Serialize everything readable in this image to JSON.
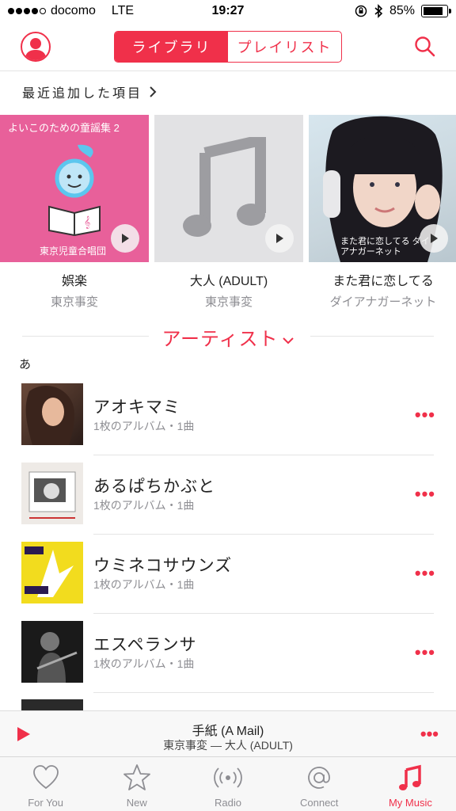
{
  "status": {
    "carrier": "docomo",
    "network": "LTE",
    "time": "19:27",
    "battery": "85%"
  },
  "header": {
    "segments": [
      "ライブラリ",
      "プレイリスト"
    ],
    "active_segment": 0
  },
  "recent": {
    "heading": "最近追加した項目",
    "albums": [
      {
        "title": "娯楽",
        "artist": "東京事変",
        "cover_text_top": "よいこのための童謡集 2",
        "cover_text_bottom": "東京児童合唱団"
      },
      {
        "title": "大人 (ADULT)",
        "artist": "東京事変"
      },
      {
        "title": "また君に恋してる",
        "artist": "ダイアナガーネット",
        "cover_text": "また君に恋してる ダイアナガーネット"
      }
    ]
  },
  "artists": {
    "heading": "アーティスト",
    "section_letter": "あ",
    "items": [
      {
        "name": "アオキマミ",
        "sub": "1枚のアルバム・1曲"
      },
      {
        "name": "あるぱちかぶと",
        "sub": "1枚のアルバム・1曲"
      },
      {
        "name": "ウミネコサウンズ",
        "sub": "1枚のアルバム・1曲"
      },
      {
        "name": "エスペランサ",
        "sub": "1枚のアルバム・1曲"
      }
    ],
    "more_label": "•••"
  },
  "now_playing": {
    "title": "手紙 (A Mail)",
    "subtitle": "東京事変 — 大人 (ADULT)",
    "more_label": "•••"
  },
  "tabs": [
    {
      "label": "For You",
      "icon": "heart-icon"
    },
    {
      "label": "New",
      "icon": "star-icon"
    },
    {
      "label": "Radio",
      "icon": "radio-icon"
    },
    {
      "label": "Connect",
      "icon": "at-icon"
    },
    {
      "label": "My Music",
      "icon": "music-note-icon"
    }
  ],
  "colors": {
    "accent": "#f0304a",
    "secondary_text": "#8e8e93"
  }
}
